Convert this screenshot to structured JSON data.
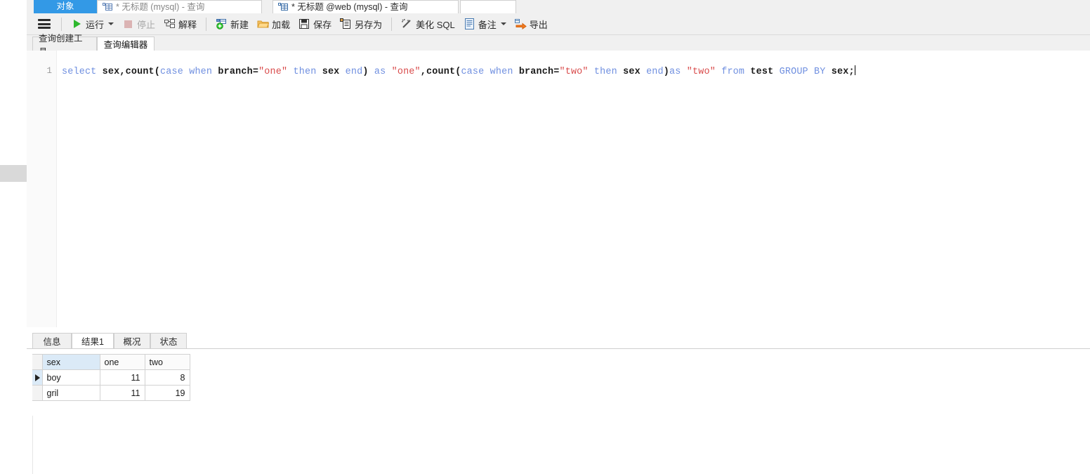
{
  "window": {
    "tabs": [
      {
        "label": "对象",
        "icon": "objects-icon",
        "state": "selected-blue"
      },
      {
        "label": "* 无标题 (mysql) - 查询",
        "icon": "query-table-icon",
        "state": "inactive"
      },
      {
        "label": "* 无标题 @web (mysql) - 查询",
        "icon": "query-table-icon",
        "state": "active"
      },
      {
        "label": "",
        "icon": "",
        "state": "empty"
      }
    ]
  },
  "toolbar": {
    "menu_icon": "hamburger-menu-icon",
    "items": [
      {
        "label": "运行",
        "icon": "play-run-icon",
        "dropdown": true,
        "enabled": true
      },
      {
        "label": "停止",
        "icon": "stop-square-icon",
        "dropdown": false,
        "enabled": false
      },
      {
        "label": "解释",
        "icon": "explain-plan-icon",
        "dropdown": false,
        "enabled": true
      },
      {
        "label": "新建",
        "icon": "new-query-plus-icon",
        "dropdown": false,
        "enabled": true
      },
      {
        "label": "加载",
        "icon": "open-folder-icon",
        "dropdown": false,
        "enabled": true
      },
      {
        "label": "保存",
        "icon": "save-floppy-icon",
        "dropdown": false,
        "enabled": true
      },
      {
        "label": "另存为",
        "icon": "save-as-icon",
        "dropdown": false,
        "enabled": true
      },
      {
        "label": "美化 SQL",
        "icon": "beautify-wand-icon",
        "dropdown": false,
        "enabled": true
      },
      {
        "label": "备注",
        "icon": "note-document-icon",
        "dropdown": true,
        "enabled": true
      },
      {
        "label": "导出",
        "icon": "export-arrow-icon",
        "dropdown": false,
        "enabled": true
      }
    ]
  },
  "editor_tabs": [
    {
      "label": "查询创建工具",
      "active": false
    },
    {
      "label": "查询编辑器",
      "active": true
    }
  ],
  "editor": {
    "line_number": "1",
    "sql_full": "select sex,count(case when branch=\"one\" then sex end) as \"one\",count(case when branch=\"two\" then sex end)as \"two\" from test GROUP BY sex;",
    "tokens": [
      {
        "t": "select",
        "c": "keyword"
      },
      {
        "t": " ",
        "c": "space"
      },
      {
        "t": "sex,count(",
        "c": "plain"
      },
      {
        "t": "case when",
        "c": "keyword"
      },
      {
        "t": " ",
        "c": "space"
      },
      {
        "t": "branch=",
        "c": "plain"
      },
      {
        "t": "\"one\"",
        "c": "string"
      },
      {
        "t": " ",
        "c": "space"
      },
      {
        "t": "then",
        "c": "keyword"
      },
      {
        "t": " ",
        "c": "space"
      },
      {
        "t": "sex ",
        "c": "plain"
      },
      {
        "t": "end",
        "c": "keyword"
      },
      {
        "t": ") ",
        "c": "plain"
      },
      {
        "t": "as",
        "c": "keyword"
      },
      {
        "t": " ",
        "c": "space"
      },
      {
        "t": "\"one\"",
        "c": "string"
      },
      {
        "t": ",count(",
        "c": "plain"
      },
      {
        "t": "case when",
        "c": "keyword"
      },
      {
        "t": " ",
        "c": "space"
      },
      {
        "t": "branch=",
        "c": "plain"
      },
      {
        "t": "\"two\"",
        "c": "string"
      },
      {
        "t": " ",
        "c": "space"
      },
      {
        "t": "then",
        "c": "keyword"
      },
      {
        "t": " ",
        "c": "space"
      },
      {
        "t": "sex ",
        "c": "plain"
      },
      {
        "t": "end",
        "c": "keyword"
      },
      {
        "t": ")",
        "c": "plain"
      },
      {
        "t": "as",
        "c": "keyword"
      },
      {
        "t": " ",
        "c": "space"
      },
      {
        "t": "\"two\"",
        "c": "string"
      },
      {
        "t": " ",
        "c": "space"
      },
      {
        "t": "from",
        "c": "keyword"
      },
      {
        "t": " ",
        "c": "space"
      },
      {
        "t": "test",
        "c": "plain"
      },
      {
        "t": " ",
        "c": "space"
      },
      {
        "t": "GROUP BY",
        "c": "keyword"
      },
      {
        "t": " ",
        "c": "space"
      },
      {
        "t": "sex;",
        "c": "plain"
      }
    ]
  },
  "results": {
    "tabs": [
      {
        "label": "信息",
        "active": false
      },
      {
        "label": "结果1",
        "active": true
      },
      {
        "label": "概况",
        "active": false
      },
      {
        "label": "状态",
        "active": false
      }
    ],
    "grid": {
      "columns": [
        "sex",
        "one",
        "two"
      ],
      "selected_column": "sex",
      "current_row_index": 0,
      "rows": [
        [
          "boy",
          "11",
          "8"
        ],
        [
          "gril",
          "11",
          "19"
        ]
      ]
    }
  },
  "colors": {
    "tab_selected_blue": "#3399e6",
    "keyword_blue": "#6f8fe0",
    "string_red": "#d94c4c",
    "grid_selection_blue": "#dbeaf7",
    "toolbar_bg": "#f0f0f0"
  }
}
